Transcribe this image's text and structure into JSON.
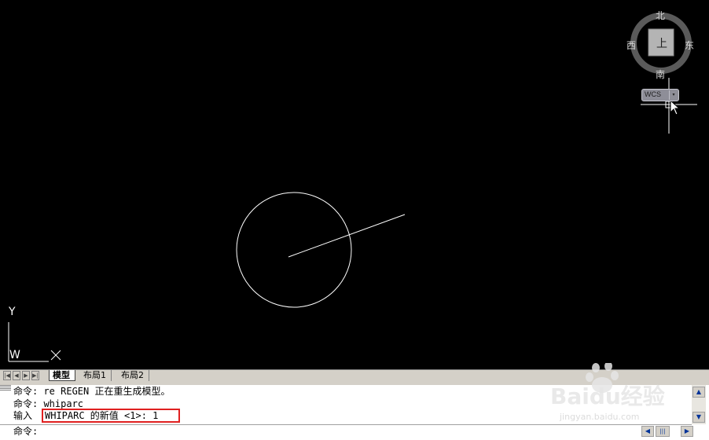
{
  "viewcube": {
    "north": "北",
    "south": "南",
    "east": "东",
    "west": "西",
    "top_face": "上",
    "coord_button": "WCS",
    "coord_dropdown_arrow": "▾"
  },
  "ucs_icon": {
    "y_label": "Y",
    "x_label": "X",
    "w_label": "W"
  },
  "tabs": {
    "nav_first": "|◀",
    "nav_prev": "◀",
    "nav_next": "▶",
    "nav_last": "▶|",
    "items": [
      {
        "label": "模型",
        "active": true
      },
      {
        "label": "布局1",
        "active": false
      },
      {
        "label": "布局2",
        "active": false
      }
    ]
  },
  "command_history": [
    "命令: re REGEN 正在重生成模型。",
    "命令: whiparc",
    "输入 "
  ],
  "command_prompt_value": "WHIPARC 的新值 <1>: 1",
  "command_current": "命令:",
  "watermark": {
    "brand": "Baidu经验",
    "url": "jingyan.baidu.com"
  },
  "colors": {
    "canvas_bg": "#000000",
    "highlight_box": "#e02020"
  }
}
